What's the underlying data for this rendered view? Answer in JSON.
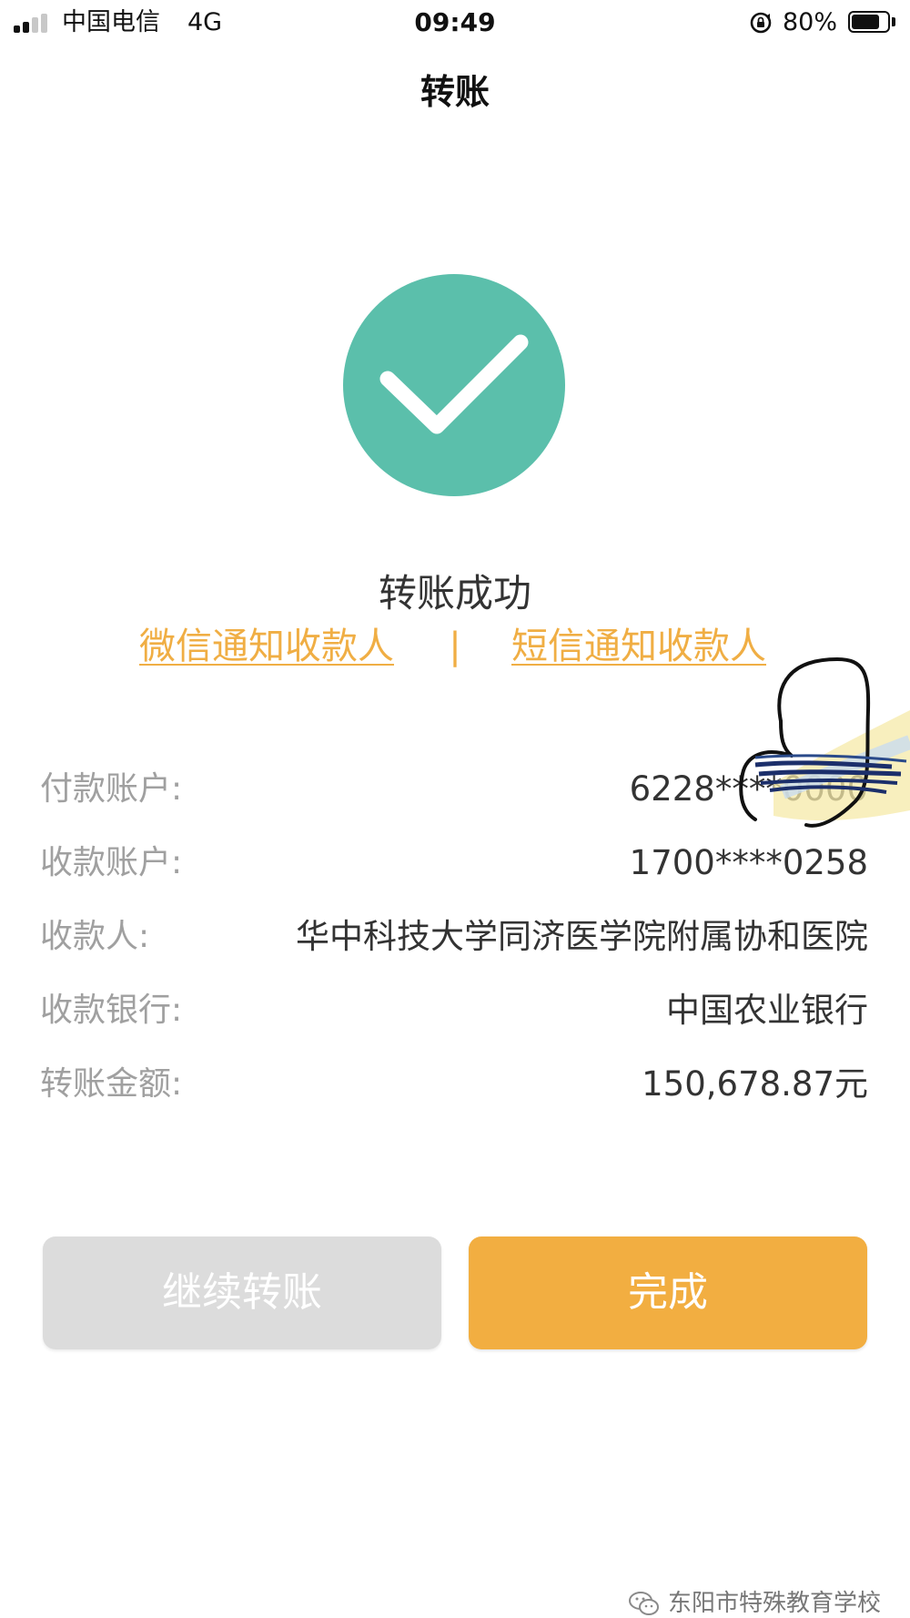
{
  "status_bar": {
    "carrier": "中国电信",
    "network": "4G",
    "time": "09:49",
    "battery_percent_label": "80%",
    "battery_level": 0.8,
    "signal_bars_active": 2,
    "signal_bars_total": 4
  },
  "nav": {
    "title": "转账"
  },
  "result": {
    "title": "转账成功",
    "icon": "check-circle-icon",
    "icon_color": "#5bbfab"
  },
  "notify": {
    "wechat_label": "微信通知收款人",
    "separator": "|",
    "sms_label": "短信通知收款人",
    "link_color": "#f0ae44"
  },
  "details": {
    "rows": [
      {
        "label": "付款账户:",
        "value": "6228****0000"
      },
      {
        "label": "收款账户:",
        "value": "1700****0258"
      },
      {
        "label": "收款人:",
        "value": "华中科技大学同济医学院附属协和医院"
      },
      {
        "label": "收款银行:",
        "value": "中国农业银行"
      },
      {
        "label": "转账金额:",
        "value": "150,678.87元"
      }
    ]
  },
  "buttons": {
    "continue_label": "继续转账",
    "continue_color": "#dcdcdc",
    "done_label": "完成",
    "done_color": "#f2ae41"
  },
  "watermark": {
    "icon": "wechat-icon",
    "text": "东阳市特殊教育学校"
  }
}
